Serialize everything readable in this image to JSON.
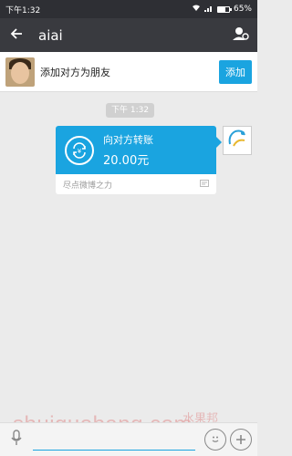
{
  "status_bar": {
    "time": "下午1:32",
    "battery": "65%",
    "battery_level": 0.65
  },
  "header": {
    "title": "aiai",
    "back_icon": "arrow-left-icon",
    "profile_icon": "person-settings-icon"
  },
  "add_friend_bar": {
    "text": "添加对方为朋友",
    "button_label": "添加"
  },
  "chat": {
    "timestamp": "下午 1:32",
    "transfer_card": {
      "label": "向对方转账",
      "amount": "20.00元",
      "note": "尽点微博之力"
    }
  },
  "input_bar": {
    "voice_icon": "microphone-icon",
    "emoji_icon": "emoji-icon",
    "more_icon": "plus-icon"
  },
  "watermark": {
    "text": "shuiguobang.com",
    "cn": "水果邦"
  },
  "colors": {
    "accent": "#1aa4e0",
    "header_bg": "#393a3f",
    "background": "#ebebeb"
  }
}
